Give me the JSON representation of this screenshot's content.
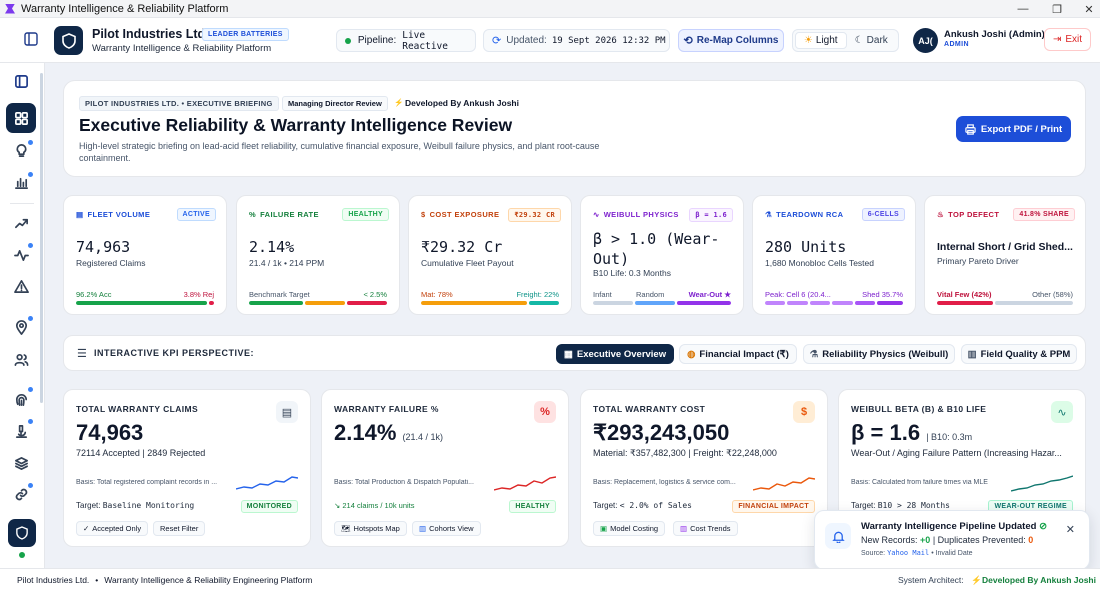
{
  "window": {
    "title": "Warranty Intelligence & Reliability Platform"
  },
  "header": {
    "company": "Pilot Industries Ltd.",
    "company_badge": "LEADER BATTERIES",
    "subtitle": "Warranty Intelligence & Reliability Platform",
    "pipeline_label": "Pipeline:",
    "pipeline_value": "Live Reactive",
    "updated_label": "Updated:",
    "updated_value": "19 Sept 2026 12:32 PM",
    "remap_label": "Re-Map Columns",
    "theme_light": "Light",
    "theme_dark": "Dark",
    "user_initials": "AJ(",
    "user_name": "Ankush Joshi (Admin)",
    "user_role": "ADMIN",
    "exit_label": "Exit"
  },
  "briefing": {
    "tag_company": "PILOT INDUSTRIES LTD. • EXECUTIVE BRIEFING",
    "tag_review": "Managing Director Review",
    "developed_by": "Developed By Ankush Joshi",
    "title": "Executive Reliability & Warranty Intelligence Review",
    "description_line1": "High-level strategic briefing on lead-acid fleet reliability, cumulative financial exposure, Weibull failure physics, and plant root-cause",
    "description_line2": "containment.",
    "export_label": "Export PDF / Print"
  },
  "kpis": [
    {
      "label": "FLEET VOLUME",
      "badge": "ACTIVE",
      "value": "74,963",
      "sub": "Registered Claims",
      "foot_left": "96.2% Acc",
      "foot_right": "3.8% Rej",
      "accent": "#1d4ed8"
    },
    {
      "label": "FAILURE RATE",
      "badge": "HEALTHY",
      "value": "2.14%",
      "sub": "21.4 / 1k • 214 PPM",
      "foot_left": "Benchmark Target",
      "foot_right": "< 2.5%",
      "accent": "#15803d"
    },
    {
      "label": "COST EXPOSURE",
      "badge": "₹29.32 CR",
      "value": "₹29.32 Cr",
      "sub": "Cumulative Fleet Payout",
      "foot_left": "Mat: 78%",
      "foot_right": "Freight: 22%",
      "accent": "#c2410c"
    },
    {
      "label": "WEIBULL PHYSICS",
      "badge": "β = 1.6",
      "value_line1": "β > 1.0 (Wear-",
      "value_line2": "Out)",
      "sub": "B10 Life: 0.3 Months",
      "foot_left": "Infant",
      "foot_mid": "Random",
      "foot_right": "Wear-Out ★",
      "accent": "#7e22ce"
    },
    {
      "label": "TEARDOWN RCA",
      "badge": "6-CELLS",
      "value": "280 Units",
      "sub": "1,680 Monobloc Cells Tested",
      "foot_left": "Peak: Cell 6 (20.4...",
      "foot_right": "Shed 35.7%",
      "accent": "#1d4ed8"
    },
    {
      "label": "TOP DEFECT",
      "badge": "41.8% SHARE",
      "value": "Internal Short / Grid Shed...",
      "sub": "Primary Pareto Driver",
      "foot_left": "Vital Few (42%)",
      "foot_right": "Other (58%)",
      "accent": "#be123c"
    }
  ],
  "perspective": {
    "label": "INTERACTIVE KPI PERSPECTIVE:",
    "tabs": [
      "Executive Overview",
      "Financial Impact (₹)",
      "Reliability Physics (Weibull)",
      "Field Quality & PPM"
    ]
  },
  "cards": [
    {
      "title": "TOTAL WARRANTY CLAIMS",
      "value": "74,963",
      "sub": "72114 Accepted | 2849 Rejected",
      "basis": "Basis: Total registered complaint records in ...",
      "target_label": "Target:",
      "target": "Baseline Monitoring",
      "status": "MONITORED",
      "buttons": [
        "Accepted Only",
        "Reset Filter"
      ]
    },
    {
      "title": "WARRANTY FAILURE %",
      "value": "2.14%",
      "value_suffix": "(21.4 / 1k)",
      "basis": "Basis: Total Production & Dispatch Populati...",
      "target": "214 claims / 10k units",
      "status": "HEALTHY",
      "buttons": [
        "Hotspots Map",
        "Cohorts View"
      ]
    },
    {
      "title": "TOTAL WARRANTY COST",
      "value": "₹293,243,050",
      "sub": "Material: ₹357,482,300 | Freight: ₹22,248,000",
      "basis": "Basis: Replacement, logistics & service com...",
      "target_label": "Target:",
      "target": "< 2.0% of Sales",
      "status": "FINANCIAL IMPACT",
      "buttons": [
        "Model Costing",
        "Cost Trends"
      ]
    },
    {
      "title": "WEIBULL BETA (B) & B10 LIFE",
      "value": "β = 1.6",
      "value_suffix": "| B10: 0.3m",
      "sub": "Wear-Out / Aging Failure Pattern (Increasing Hazar...",
      "basis": "Basis: Calculated from failure times via MLE",
      "target_label": "Target:",
      "target": "B10 > 28 Months",
      "status": "WEAR-OUT REGIME"
    }
  ],
  "toast": {
    "title": "Warranty Intelligence Pipeline Updated",
    "new_label": "New Records:",
    "new_value": "+0",
    "dup_label": "Duplicates Prevented:",
    "dup_value": "0",
    "source_label": "Source:",
    "source_value": "Yahoo Mail",
    "source_suffix": "• Invalid Date"
  },
  "footer": {
    "company": "Pilot Industries Ltd.",
    "sep": "•",
    "platform": "Warranty Intelligence & Reliability Engineering Platform",
    "architect_label": "System Architect:",
    "architect": "Developed By Ankush Joshi"
  }
}
